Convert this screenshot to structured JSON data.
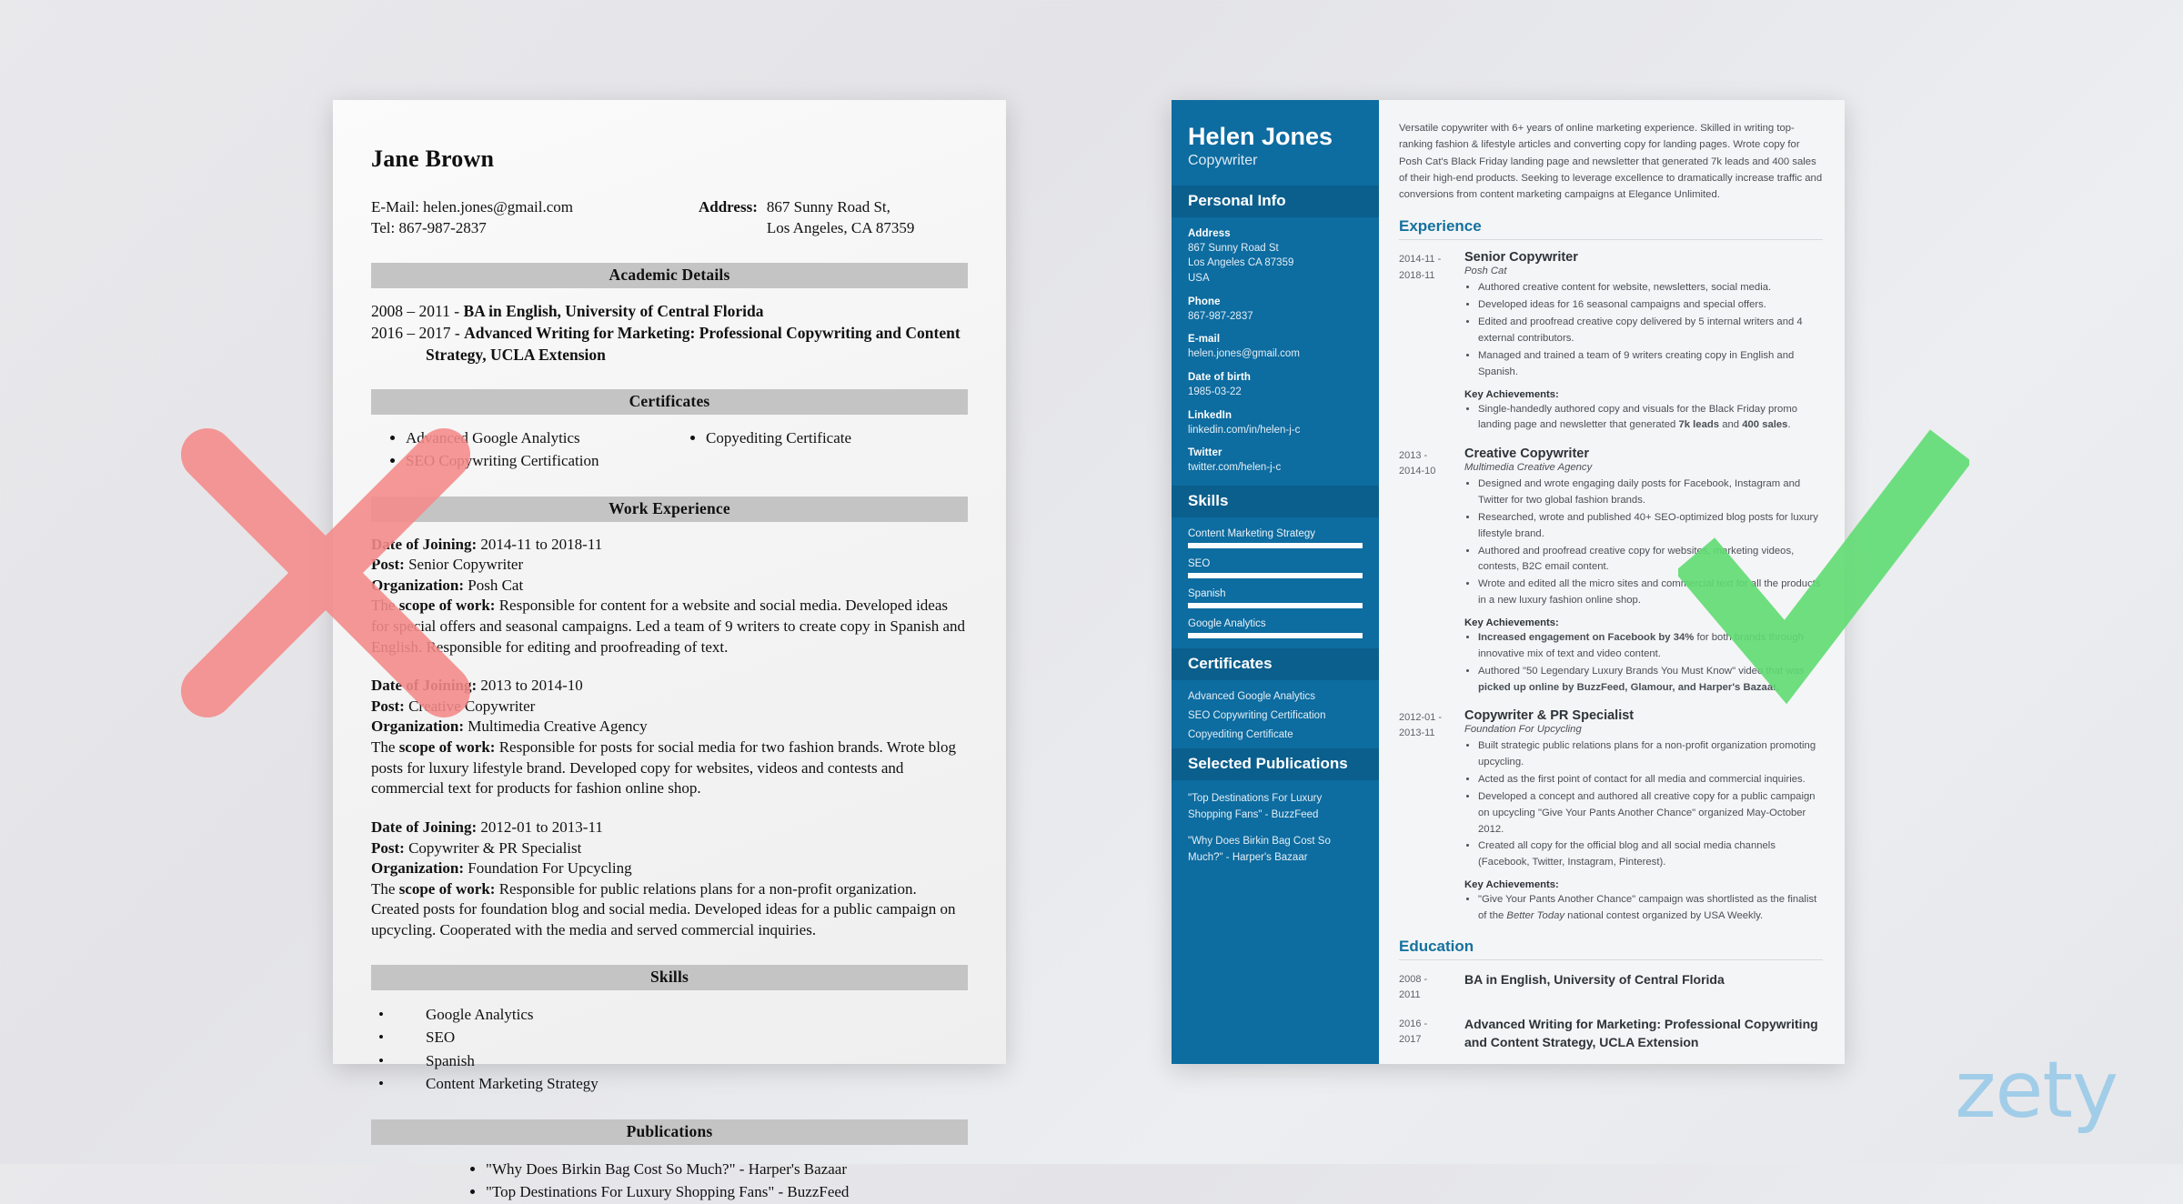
{
  "bad_resume": {
    "name": "Jane Brown",
    "email_line": "E-Mail: helen.jones@gmail.com",
    "tel_line": "Tel: 867-987-2837",
    "address_label": "Address:",
    "address_line1": "867 Sunny Road St,",
    "address_line2": "Los Angeles, CA 87359",
    "sections": {
      "academic": "Academic Details",
      "certificates": "Certificates",
      "work": "Work Experience",
      "skills": "Skills",
      "publications": "Publications"
    },
    "education": [
      {
        "years": "2008 – 2011 - ",
        "title": "BA in English, University of Central Florida",
        "indent": ""
      },
      {
        "years": "2016 – 2017 - ",
        "title": "Advanced Writing for Marketing: Professional Copywriting and Content",
        "indent": "Strategy, UCLA Extension"
      }
    ],
    "certificates_col1": [
      "Advanced Google Analytics",
      "SEO Copywriting Certification"
    ],
    "certificates_col2": [
      "Copyediting Certificate"
    ],
    "jobs": [
      {
        "date_label": "Date of Joining:",
        "date_value": " 2014-11 to 2018-11",
        "post_label": "Post:",
        "post_value": " Senior Copywriter",
        "org_label": "Organization:",
        "org_value": " Posh Cat",
        "scope_prefix": "The ",
        "scope_label": "scope of work:",
        "scope_value": " Responsible for content for a website and social media. Developed ideas for special offers and seasonal campaigns. Led a team of 9 writers to create copy in Spanish and English. Responsible for editing and proofreading of text."
      },
      {
        "date_label": "Date of Joining:",
        "date_value": " 2013  to 2014-10",
        "post_label": "Post:",
        "post_value": " Creative Copywriter",
        "org_label": "Organization:",
        "org_value": " Multimedia Creative Agency",
        "scope_prefix": "The ",
        "scope_label": "scope of work:",
        "scope_value": " Responsible for posts for social media for two fashion brands. Wrote blog posts for luxury lifestyle brand. Developed copy for websites, videos and contests and commercial text for products for fashion online shop."
      },
      {
        "date_label": "Date of Joining:",
        "date_value": " 2012-01 to 2013-11",
        "post_label": "Post:",
        "post_value": " Copywriter & PR Specialist",
        "org_label": "Organization:",
        "org_value": " Foundation For Upcycling",
        "scope_prefix": "The ",
        "scope_label": "scope of work:",
        "scope_value": " Responsible for public relations plans for a non-profit organization. Created posts for foundation blog and social media. Developed ideas for a public campaign on upcycling. Cooperated with the media and served commercial inquiries."
      }
    ],
    "skills": [
      "Google Analytics",
      "SEO",
      "Spanish",
      "Content Marketing Strategy"
    ],
    "publications": [
      "\"Why Does Birkin Bag Cost So Much?\" - Harper's Bazaar",
      "\"Top Destinations For Luxury Shopping Fans\" - BuzzFeed"
    ]
  },
  "good_resume": {
    "sidebar": {
      "name": "Helen Jones",
      "role": "Copywriter",
      "personal_info_head": "Personal Info",
      "fields": [
        {
          "label": "Address",
          "value": "867 Sunny Road St\nLos Angeles CA 87359\nUSA"
        },
        {
          "label": "Phone",
          "value": "867-987-2837"
        },
        {
          "label": "E-mail",
          "value": "helen.jones@gmail.com"
        },
        {
          "label": "Date of birth",
          "value": "1985-03-22"
        },
        {
          "label": "LinkedIn",
          "value": "linkedin.com/in/helen-j-c"
        },
        {
          "label": "Twitter",
          "value": "twitter.com/helen-j-c"
        }
      ],
      "skills_head": "Skills",
      "skills": [
        {
          "name": "Content Marketing Strategy",
          "level": 100
        },
        {
          "name": "SEO",
          "level": 100
        },
        {
          "name": "Spanish",
          "level": 100
        },
        {
          "name": "Google Analytics",
          "level": 100
        }
      ],
      "certificates_head": "Certificates",
      "certificates": [
        "Advanced Google Analytics",
        "SEO Copywriting Certification",
        "Copyediting Certificate"
      ],
      "publications_head": "Selected Publications",
      "publications": [
        "\"Top Destinations For Luxury Shopping Fans\" - BuzzFeed",
        "\"Why Does Birkin Bag Cost So Much?\" - Harper's Bazaar"
      ]
    },
    "main": {
      "summary": "Versatile copywriter with 6+ years of online marketing experience. Skilled in writing top-ranking fashion & lifestyle articles and converting copy for landing pages. Wrote copy for Posh Cat's Black Friday landing page and newsletter that generated 7k leads and 400 sales of their high-end products. Seeking to leverage excellence to dramatically increase traffic and conversions from content marketing campaigns at Elegance Unlimited.",
      "experience_head": "Experience",
      "key_achievements_label": "Key Achievements:",
      "experience": [
        {
          "dates": "2014-11 - 2018-11",
          "title": "Senior Copywriter",
          "company": "Posh Cat",
          "bullets": [
            "Authored creative content for website, newsletters, social media.",
            "Developed ideas for 16 seasonal campaigns and special offers.",
            "Edited and proofread creative copy delivered by 5 internal writers and 4 external contributors.",
            "Managed and trained a team of 9 writers creating copy in English and Spanish."
          ],
          "achievements": [
            "Single-handedly authored copy and visuals for the Black Friday promo landing page and newsletter that generated <b>7k leads</b> and <b>400 sales</b>."
          ]
        },
        {
          "dates": "2013 - 2014-10",
          "title": "Creative Copywriter",
          "company": "Multimedia Creative Agency",
          "bullets": [
            "Designed and wrote engaging daily posts for Facebook, Instagram and Twitter for two global fashion brands.",
            "Researched, wrote and published 40+ SEO-optimized blog posts for luxury lifestyle brand.",
            "Authored and proofread creative copy for websites, marketing videos, contests, B2C email content.",
            "Wrote and edited all the micro sites and commercial text for all the products in a new luxury fashion online shop."
          ],
          "achievements": [
            "<b>Increased engagement on Facebook by 34%</b> for both brands through innovative mix of text and video content.",
            "Authored \"50 Legendary Luxury Brands You Must Know\" video that was <b>picked up online by BuzzFeed, Glamour, and Harper's Bazaar.</b>"
          ]
        },
        {
          "dates": "2012-01 - 2013-11",
          "title": "Copywriter & PR Specialist",
          "company": "Foundation For Upcycling",
          "bullets": [
            "Built strategic public relations plans for a non-profit organization promoting upcycling.",
            "Acted as the first point of contact for all media and commercial inquiries.",
            "Developed a concept and authored all creative copy for a public campaign on upcycling \"Give Your Pants Another Chance\" organized May-October 2012.",
            "Created all copy for the official blog and all social media channels (Facebook, Twitter, Instagram, Pinterest)."
          ],
          "achievements": [
            "\"Give Your Pants Another Chance\" campaign was shortlisted as the finalist of the <i>Better Today</i> national contest organized by USA Weekly."
          ]
        }
      ],
      "education_head": "Education",
      "education": [
        {
          "dates": "2008 - 2011",
          "title": "BA in English, University of Central Florida"
        },
        {
          "dates": "2016 - 2017",
          "title": "Advanced Writing for Marketing: Professional Copywriting and Content Strategy, UCLA Extension"
        }
      ]
    }
  },
  "marks": {
    "reject_icon": "x-mark-red",
    "approve_icon": "check-mark-green",
    "reject_color": "#f58a8a",
    "approve_color": "#5fdb72"
  },
  "branding": {
    "logo_text": "zety",
    "logo_color": "#9ccbe8"
  }
}
